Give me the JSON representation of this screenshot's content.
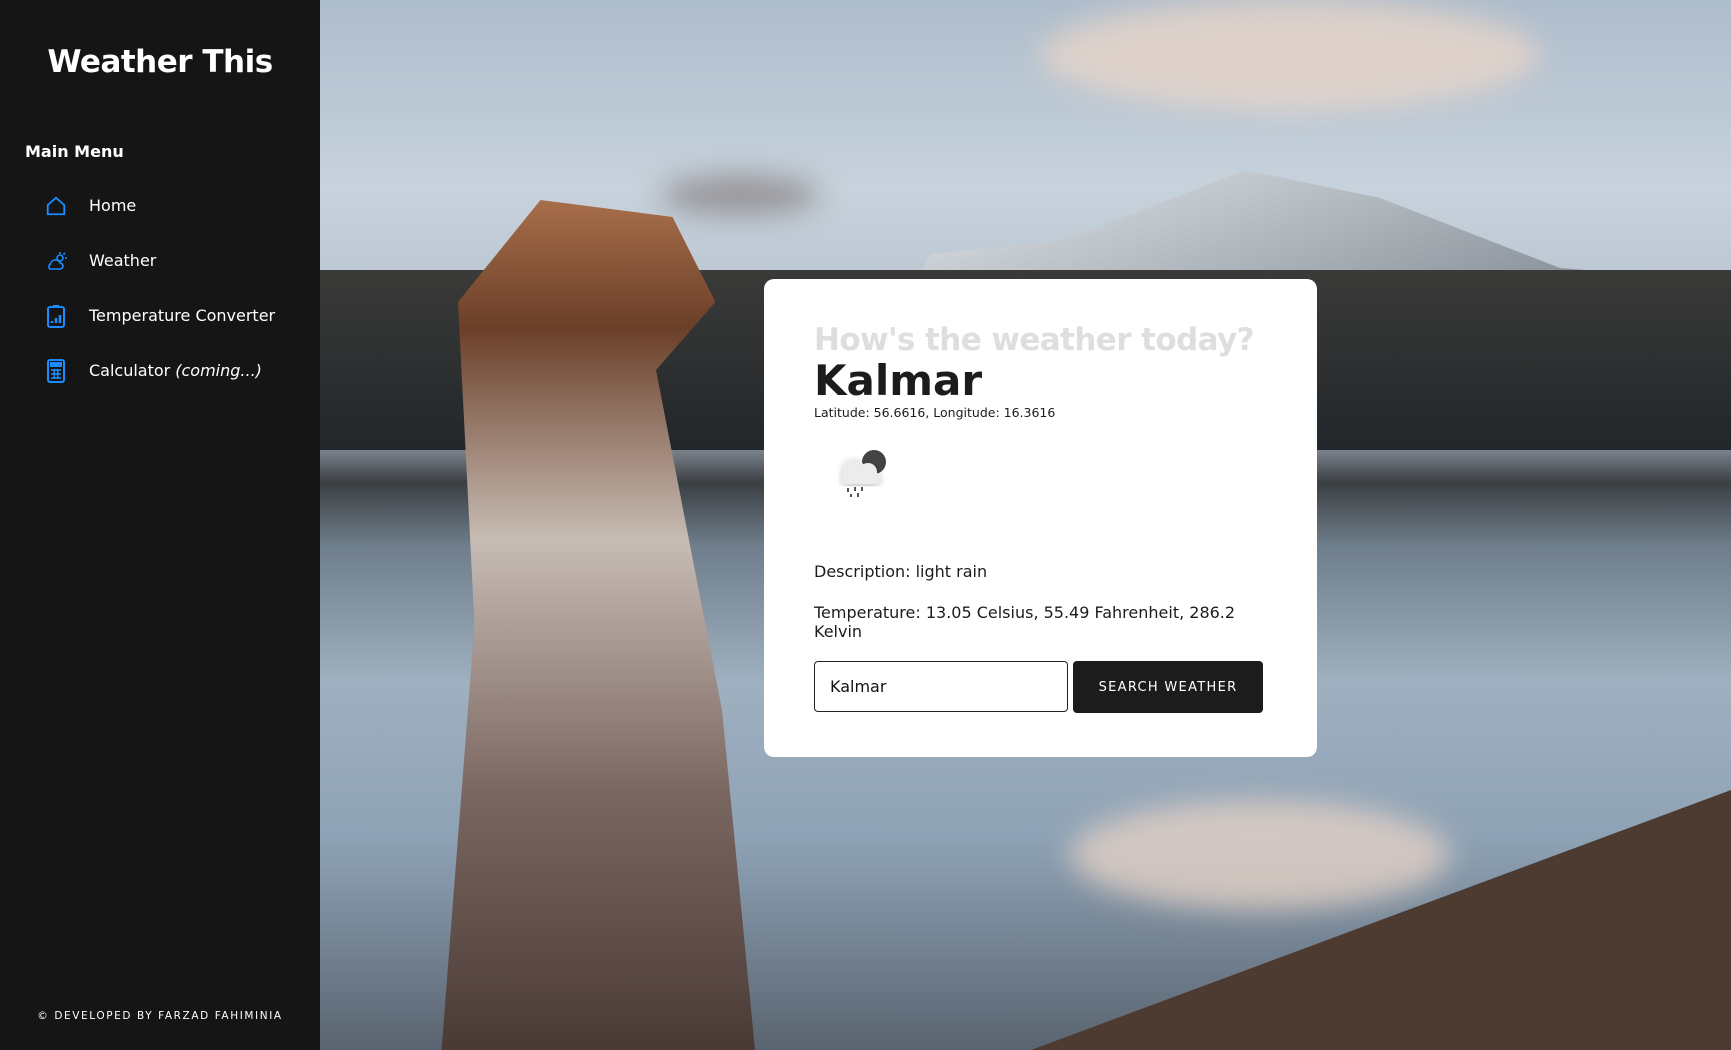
{
  "sidebar": {
    "title": "Weather This",
    "menu_title": "Main Menu",
    "items": [
      {
        "label": "Home",
        "icon": "home-icon"
      },
      {
        "label": "Weather",
        "icon": "weather-icon"
      },
      {
        "label": "Temperature Converter",
        "icon": "clipboard-chart-icon"
      },
      {
        "label": "Calculator",
        "suffix": "(coming...)",
        "icon": "calculator-icon"
      }
    ],
    "footer": "© DEVELOPED BY FARZAD FAHIMINIA",
    "accent": "#1a8cff"
  },
  "card": {
    "question": "How's the weather today?",
    "city": "Kalmar",
    "coords": "Latitude: 56.6616, Longitude: 16.3616",
    "icon": "light-rain-night-icon",
    "description": "Description: light rain",
    "temperature": "Temperature: 13.05 Celsius, 55.49 Fahrenheit, 286.2 Kelvin",
    "search_value": "Kalmar",
    "search_button": "SEARCH WEATHER"
  }
}
